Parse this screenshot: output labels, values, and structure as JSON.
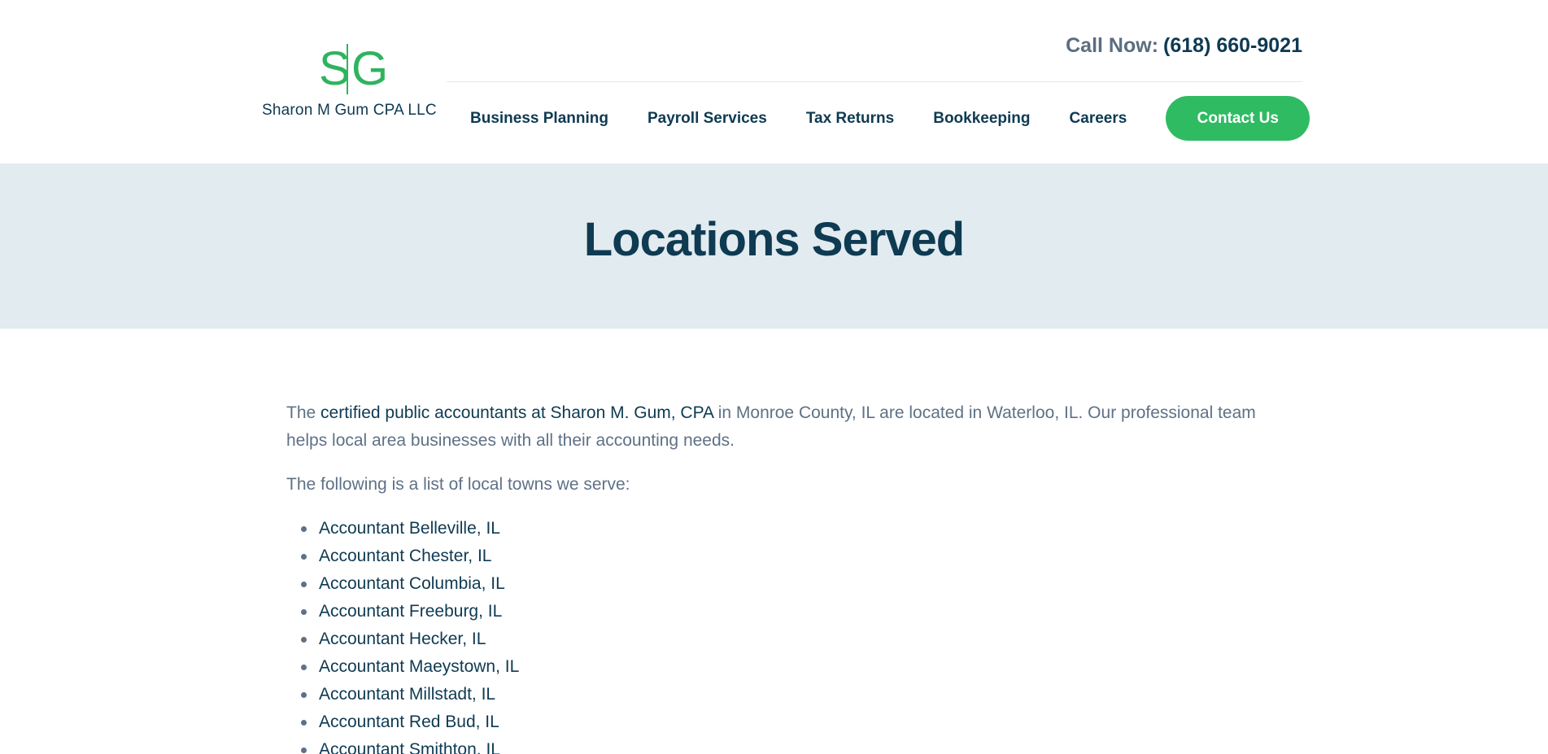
{
  "brand": {
    "logo_left": "S",
    "logo_right": "G",
    "name": "Sharon M Gum CPA LLC",
    "accent_color": "#2fbb62",
    "navy_color": "#0e3a52"
  },
  "header": {
    "call_label": "Call Now:",
    "phone": "(618) 660-9021",
    "nav": [
      {
        "label": "Business Planning"
      },
      {
        "label": "Payroll Services"
      },
      {
        "label": "Tax Returns"
      },
      {
        "label": "Bookkeeping"
      },
      {
        "label": "Careers"
      }
    ],
    "contact_label": "Contact Us"
  },
  "hero": {
    "title": "Locations Served"
  },
  "content": {
    "intro_prefix": "The ",
    "intro_link": "certified public accountants at Sharon M. Gum, CPA",
    "intro_suffix": " in Monroe County, IL are located in Waterloo, IL. Our professional team helps local area businesses with all their accounting needs.",
    "list_intro": "The following is a list of local towns we serve:",
    "towns": [
      "Accountant Belleville, IL",
      "Accountant Chester, IL",
      "Accountant Columbia, IL",
      "Accountant Freeburg, IL",
      "Accountant Hecker, IL",
      "Accountant Maeystown, IL",
      "Accountant Millstadt, IL",
      "Accountant Red Bud, IL",
      "Accountant Smithton, IL"
    ]
  }
}
